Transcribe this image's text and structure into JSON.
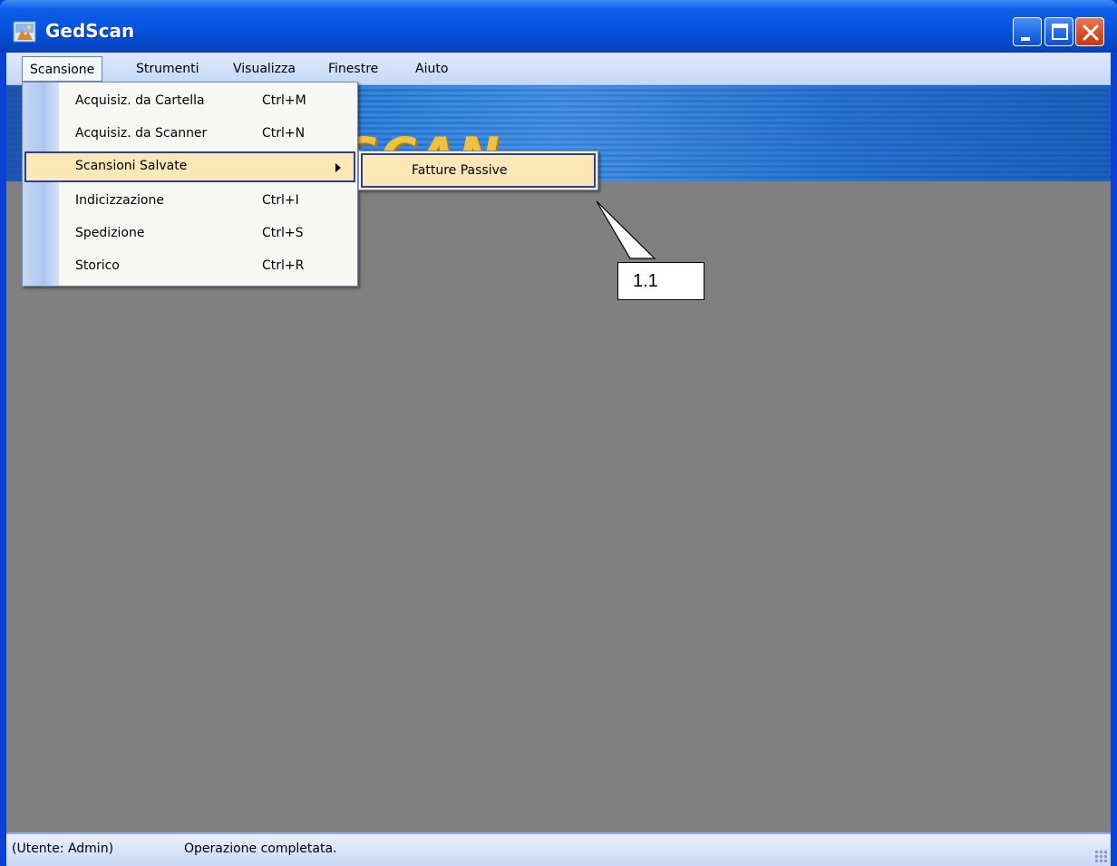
{
  "window": {
    "title": "GedScan"
  },
  "menubar": {
    "items": [
      "Scansione",
      "Strumenti",
      "Visualizza",
      "Finestre",
      "Aiuto"
    ]
  },
  "banner": {
    "logo_text": "SCAN"
  },
  "dropdown": {
    "items": [
      {
        "label": "Acquisiz. da Cartella",
        "shortcut": "Ctrl+M"
      },
      {
        "label": "Acquisiz. da Scanner",
        "shortcut": "Ctrl+N"
      },
      {
        "label": "Scansioni Salvate",
        "shortcut": ""
      },
      {
        "label": "Indicizzazione",
        "shortcut": "Ctrl+I"
      },
      {
        "label": "Spedizione",
        "shortcut": "Ctrl+S"
      },
      {
        "label": "Storico",
        "shortcut": "Ctrl+R"
      }
    ]
  },
  "submenu": {
    "items": [
      {
        "label": "Fatture Passive"
      }
    ]
  },
  "callout": {
    "label": "1.1"
  },
  "statusbar": {
    "user": "(Utente: Admin)",
    "message": "Operazione completata."
  },
  "colors": {
    "titlebar": "#0553de",
    "highlight": "#fbe8b6",
    "highlight_border": "#2b3f9a",
    "workspace": "#808080"
  }
}
